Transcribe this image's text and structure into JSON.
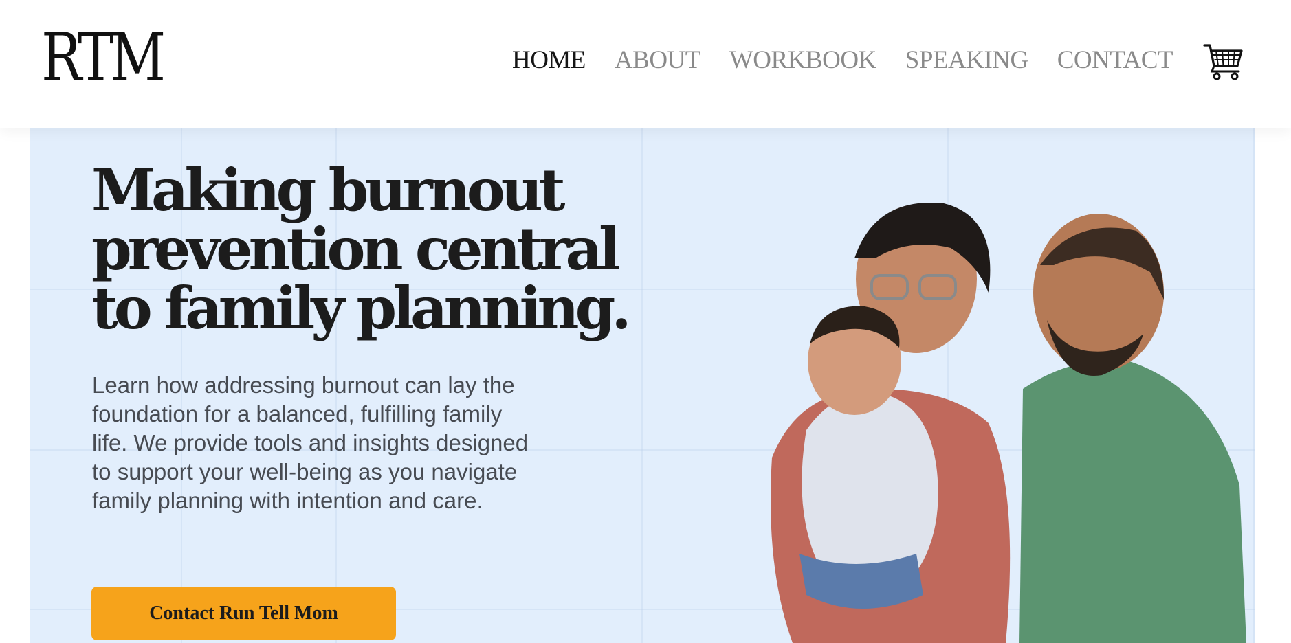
{
  "header": {
    "logo": "RTM",
    "nav": [
      "HOME",
      "ABOUT",
      "WORKBOOK",
      "SPEAKING",
      "CONTACT"
    ],
    "active_nav": "HOME",
    "cart_icon": "shopping-cart-icon"
  },
  "hero": {
    "headline": "Making burnout prevention central to family planning.",
    "subtext": "Learn how addressing burnout can lay the foundation for a balanced, fulfilling family life. We provide tools and insights designed to support your well-being as you navigate family planning with intention and care.",
    "cta_label": "Contact Run Tell Mom",
    "image": "family-photo",
    "colors": {
      "background": "#e2eefc",
      "cta": "#f6a31b",
      "text_dark": "#1c1c1c",
      "nav_inactive": "#8a8a8a"
    }
  }
}
